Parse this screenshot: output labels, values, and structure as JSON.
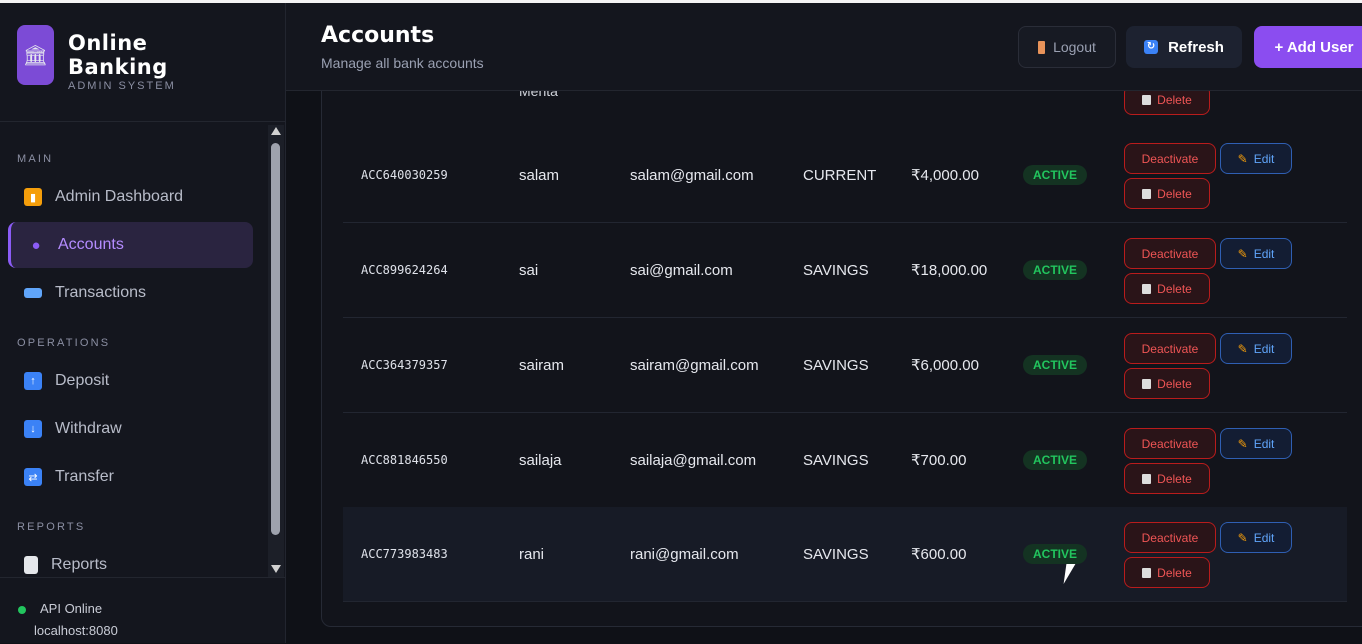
{
  "brand": {
    "title": "Online Banking",
    "subtitle": "ADMIN SYSTEM",
    "icon": "bank-icon"
  },
  "sidebar": {
    "sections": [
      {
        "label": "MAIN"
      },
      {
        "label": "OPERATIONS"
      },
      {
        "label": "REPORTS"
      }
    ],
    "items": [
      {
        "label": "Admin Dashboard",
        "icon": "chart-icon",
        "color": "#f59e0b"
      },
      {
        "label": "Accounts",
        "icon": "user-icon",
        "color": "#8b5cf6",
        "active": true
      },
      {
        "label": "Transactions",
        "icon": "card-icon",
        "color": "#60a5fa"
      },
      {
        "label": "Deposit",
        "icon": "arrow-up-icon",
        "color": "#3b82f6"
      },
      {
        "label": "Withdraw",
        "icon": "arrow-down-icon",
        "color": "#3b82f6"
      },
      {
        "label": "Transfer",
        "icon": "transfer-icon",
        "color": "#3b82f6"
      },
      {
        "label": "Reports",
        "icon": "document-icon",
        "color": "#e5e7eb"
      }
    ],
    "api_status": "API Online",
    "api_host": "localhost:8080"
  },
  "header": {
    "title": "Accounts",
    "subtitle": "Manage all bank accounts",
    "logout_label": "Logout",
    "refresh_label": "Refresh",
    "add_user_label": "+ Add User"
  },
  "table": {
    "partial_name": "Mehta",
    "partial_delete": "Delete",
    "rows": [
      {
        "account": "ACC640030259",
        "name": "salam",
        "email": "salam@gmail.com",
        "type": "CURRENT",
        "balance": "₹4,000.00",
        "status": "ACTIVE"
      },
      {
        "account": "ACC899624264",
        "name": "sai",
        "email": "sai@gmail.com",
        "type": "SAVINGS",
        "balance": "₹18,000.00",
        "status": "ACTIVE"
      },
      {
        "account": "ACC364379357",
        "name": "sairam",
        "email": "sairam@gmail.com",
        "type": "SAVINGS",
        "balance": "₹6,000.00",
        "status": "ACTIVE"
      },
      {
        "account": "ACC881846550",
        "name": "sailaja",
        "email": "sailaja@gmail.com",
        "type": "SAVINGS",
        "balance": "₹700.00",
        "status": "ACTIVE"
      },
      {
        "account": "ACC773983483",
        "name": "rani",
        "email": "rani@gmail.com",
        "type": "SAVINGS",
        "balance": "₹600.00",
        "status": "ACTIVE"
      }
    ],
    "actions": {
      "deactivate": "Deactivate",
      "edit": "Edit",
      "delete": "Delete"
    }
  },
  "colors": {
    "accent": "#8b4df0",
    "active": "#22c55e",
    "danger": "#ef5555",
    "edit": "#60a5fa"
  }
}
